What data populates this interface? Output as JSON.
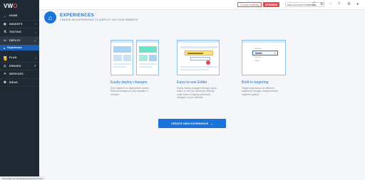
{
  "app": {
    "logo": "VWO"
  },
  "sidebar": {
    "items": [
      {
        "label": "HOME",
        "icon": "home-icon",
        "glyph": "⌂",
        "chevron": ""
      },
      {
        "label": "INSIGHTS",
        "icon": "insights-icon",
        "glyph": "◉",
        "chevron": "›"
      },
      {
        "label": "TESTING",
        "icon": "testing-icon",
        "glyph": "⚗",
        "chevron": "›"
      },
      {
        "label": "DEPLOY",
        "icon": "deploy-icon",
        "glyph": "▭",
        "chevron": "⌄"
      }
    ],
    "sub_item": {
      "label": "Experiences",
      "icon": "experiences-icon",
      "glyph": "●"
    },
    "items_after": [
      {
        "label": "PLAN",
        "icon": "plan-icon",
        "glyph": "▦",
        "chevron": "›"
      },
      {
        "label": "ERRORS",
        "icon": "errors-icon",
        "glyph": "⚠",
        "chevron": "↗"
      },
      {
        "label": "SERVICES",
        "icon": "services-icon",
        "glyph": "✦",
        "chevron": ""
      },
      {
        "label": "IDEAS",
        "icon": "ideas-icon",
        "glyph": "✺",
        "chevron": ""
      }
    ]
  },
  "header": {
    "trial_text": "23 days remaining",
    "upgrade_label": "UPGRADE",
    "account_label": "MAIN ACCOUNT #7000079",
    "icons": [
      "bell-icon",
      "gift-icon",
      "apps-icon",
      "help-icon",
      "settings-icon",
      "user-icon"
    ]
  },
  "page": {
    "title": "EXPERIENCES",
    "subtitle": "CREATE AN EXPERIENCE TO DEPLOY ON YOUR WEBSITE"
  },
  "features": [
    {
      "title": "Easily deploy changes",
      "desc": [
        "Don't depend on deployment cycles.",
        "Rollout changes on your website in",
        "minutes."
      ]
    },
    {
      "title": "Easy-to-use Editor",
      "desc": [
        "Easily deploy changes through visual",
        "editor or use our developer-friendly",
        "code editor to deploy advanced",
        "changes to your website."
      ]
    },
    {
      "title": "Built-in targeting",
      "desc": [
        "Target experiences to different",
        "segments through comprehensive",
        "segment gallery."
      ],
      "options": [
        "Desktop",
        "Mobile",
        "Desktop",
        "Tablet"
      ]
    }
  ],
  "create_button": {
    "label": "CREATE NEW EXPERIENCE"
  },
  "status_bar": {
    "url": "https://app.vwo.com/#/deploy/experience/new"
  },
  "colors": {
    "accent": "#1a73d9",
    "sidebar": "#1f2933",
    "danger": "#e5484d"
  }
}
